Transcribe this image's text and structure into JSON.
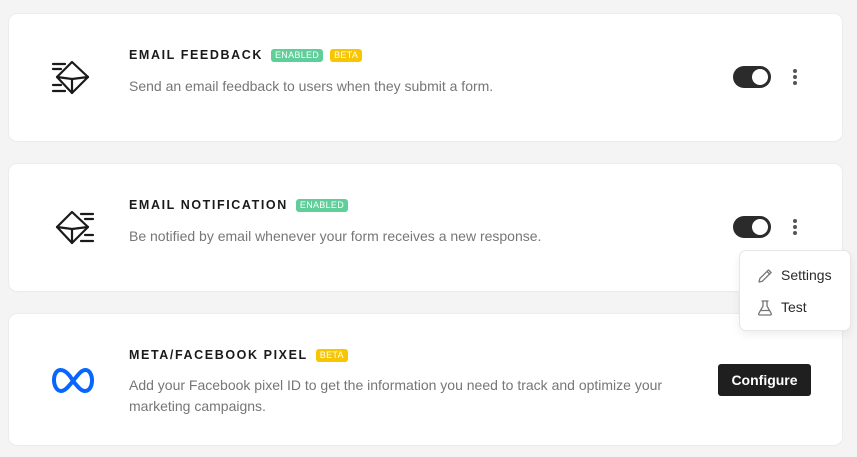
{
  "integrations": [
    {
      "title": "EMAIL FEEDBACK",
      "badges": [
        "ENABLED",
        "BETA"
      ],
      "description": "Send an email feedback to users when they submit a form.",
      "icon": "email-feedback-icon",
      "enabled": true
    },
    {
      "title": "EMAIL NOTIFICATION",
      "badges": [
        "ENABLED"
      ],
      "description": "Be notified by email whenever your form receives a new response.",
      "icon": "email-notification-icon",
      "enabled": true
    },
    {
      "title": "META/FACEBOOK PIXEL",
      "badges": [
        "BETA"
      ],
      "description": "Add your Facebook pixel ID to get the information you need to track and optimize your marketing campaigns.",
      "icon": "meta-logo-icon",
      "action_label": "Configure"
    }
  ],
  "dropdown": {
    "items": [
      {
        "label": "Settings",
        "icon": "pencil-icon"
      },
      {
        "label": "Test",
        "icon": "flask-icon"
      }
    ]
  },
  "colors": {
    "enabled_badge": "#5ecf99",
    "beta_badge": "#f7c600",
    "toggle_on": "#2b2b2b",
    "meta_blue": "#0866ff"
  }
}
